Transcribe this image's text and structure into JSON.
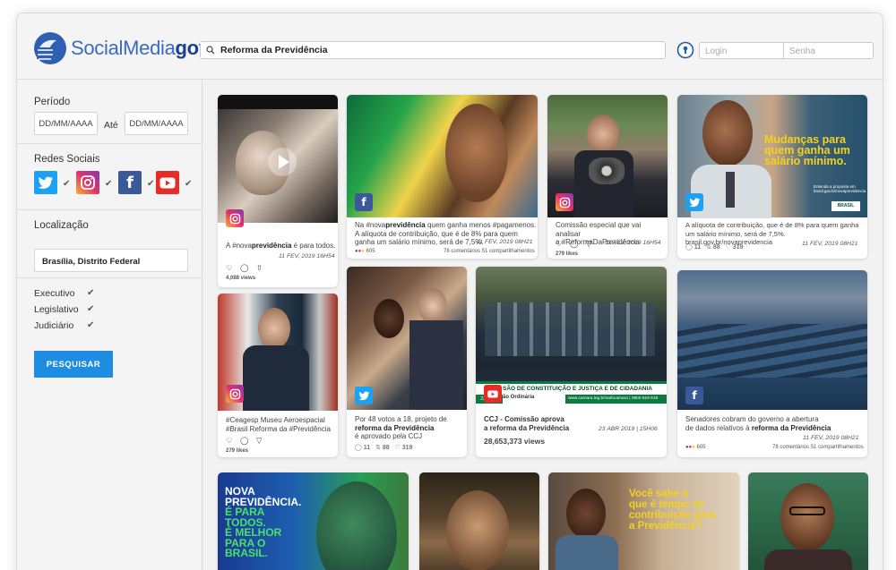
{
  "brand": {
    "prefix": "SocialMedia",
    "suffix": "gov"
  },
  "search": {
    "value": "Reforma da Previdência"
  },
  "auth": {
    "login_placeholder": "Login",
    "senha_placeholder": "Senha"
  },
  "sidebar": {
    "periodo_label": "Período",
    "date_from": "DD/MM/AAAA",
    "ate_label": "Até",
    "date_to": "DD/MM/AAAA",
    "redes_label": "Redes Sociais",
    "localizacao_label": "Localização",
    "localizacao_value": "Brasília, Distrito Federal",
    "poderes": [
      "Executivo",
      "Legislativo",
      "Judiciário"
    ],
    "search_button": "PESQUISAR"
  },
  "colors": {
    "twitter": "#1da1f2",
    "facebook": "#3b5998",
    "youtube": "#e52d27",
    "instagram": "#c1358c",
    "accent": "#1e8ce0"
  },
  "cards": {
    "c1": {
      "caption": "A #nova",
      "caption_b": "previdência",
      "caption_end": " é para todos.",
      "meta": "11 FEV, 2019 16H54",
      "views": "4,088 views"
    },
    "c2": {
      "line1a": "Na #nova",
      "line1b": "previdência",
      "line1c": " quem ganha menos #pagamenos.",
      "line2": "A alíquota de contribuição, que é de 8% para quem",
      "line3": "ganha um salário mínimo, será de 7,5%.",
      "meta": "11 FEV, 2019 08H21",
      "reactions": "605",
      "stats": "78 comentários  51 compartilhamentos"
    },
    "c3": {
      "line1": "Comissão especial que vai analisar",
      "line2": "a #ReformaDaPrevidência",
      "meta": "11 FEV, 2019 16H54",
      "likes": "279 likes"
    },
    "c4": {
      "overlay1": "Mudanças para",
      "overlay2": "quem ganha um",
      "overlay3": "salário mínimo.",
      "overlay_small1": "Entenda a proposta em",
      "overlay_small2": "brasil.gov.br/novaprevidencia",
      "gov_badge": "BRASIL",
      "line1": "A alíquota de contribuição, que é de 8% para quem ganha",
      "line2": "um salário mínimo, será de 7,5%. brasil.gov.br/novaprevidencia",
      "meta": "11 FEV, 2019 08H21",
      "replies": "11",
      "retweets": "88",
      "likes": "319"
    },
    "c5": {
      "line1": "#Ceagesp Museu Aeroespacial",
      "line2": "#Brasil Reforma da #Previdência",
      "likes": "279 likes"
    },
    "c6": {
      "line1": "Por 48 votos a 18, projeto de",
      "line2": "reforma da Previdência",
      "line3": "é aprovado pela CCJ",
      "replies": "11",
      "retweets": "88",
      "likes": "319"
    },
    "c7": {
      "banner1": "SÃO DE CONSTITUIÇÃO E JUSTIÇA E DE CIDADANIA",
      "banner_date": "23/04/19",
      "banner2": "ão Ordinária",
      "banner_url": "www.camara.leg.br/webcamara | 0800 619 619",
      "line1": "CCJ - Comissão aprova",
      "line2": "a reforma da Previdência",
      "meta": "23 ABR 2019 | 15H06",
      "views": "28,653,373 views"
    },
    "c8": {
      "line1": "Senadores cobram do governo a abertura",
      "line2": "de dados relativos à ",
      "line2b": "reforma da Previdência",
      "meta": "11 FEV, 2019 08H21",
      "reactions": "605",
      "stats": "78 comentários  51 compartilhamentos"
    },
    "c9": {
      "l1": "NOVA",
      "l2": "PREVIDÊNCIA.",
      "l3": "É PARA",
      "l4": "TODOS.",
      "l5": "É MELHOR",
      "l6": "PARA O",
      "l7": "BRASIL."
    },
    "c11": {
      "l1": "Você sabe o",
      "l2": "que é tempo de",
      "l3": "contribuição para",
      "l4": "a Previdência?"
    }
  }
}
